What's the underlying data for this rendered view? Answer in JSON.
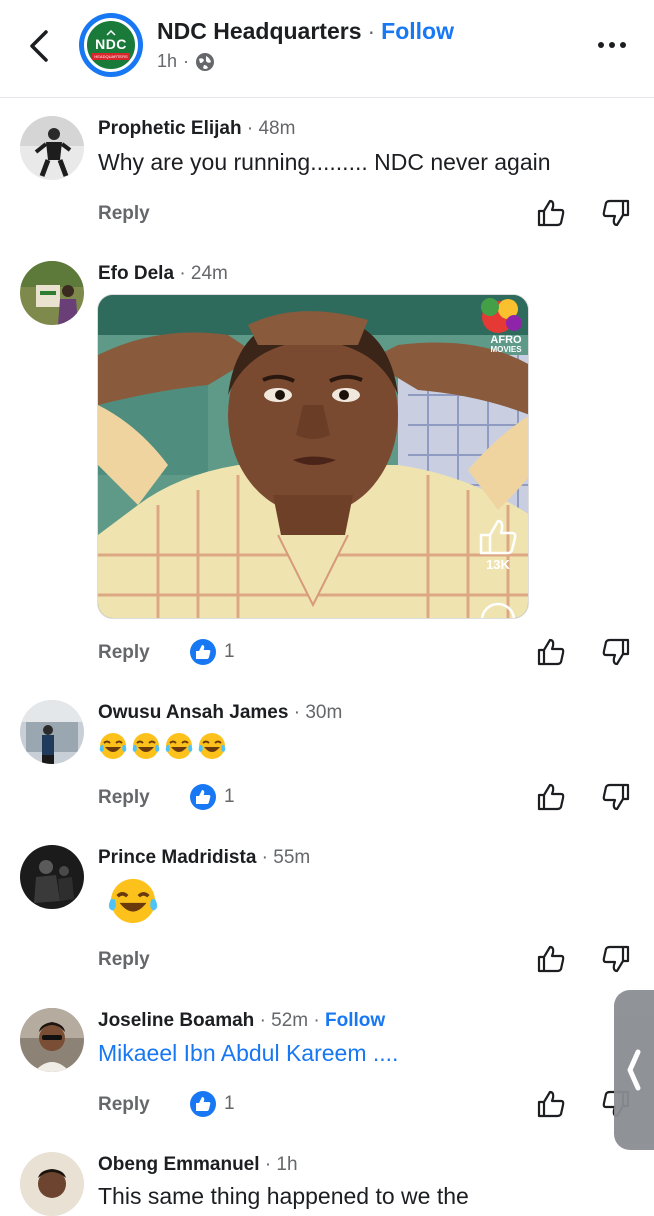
{
  "header": {
    "page_name": "NDC Headquarters",
    "separator": "·",
    "follow_label": "Follow",
    "time": "1h",
    "logo_text": "NDC",
    "logo_subtext": "HEADQUARTERS"
  },
  "comments": [
    {
      "author": "Prophetic Elijah",
      "time": "48m",
      "text": "Why are you running......... NDC never again",
      "reply_label": "Reply"
    },
    {
      "author": "Efo Dela",
      "time": "24m",
      "reply_label": "Reply",
      "like_count": "1",
      "media": {
        "watermark_line1": "AFRO",
        "watermark_line2": "MOVIES",
        "overlay_like_count": "13K"
      }
    },
    {
      "author": "Owusu Ansah James",
      "time": "30m",
      "emoji_count": 4,
      "emoji": "tears-of-joy",
      "reply_label": "Reply",
      "like_count": "1"
    },
    {
      "author": "Prince Madridista",
      "time": "55m",
      "emoji": "tears-of-joy",
      "reply_label": "Reply"
    },
    {
      "author": "Joseline Boamah",
      "time": "52m",
      "follow_label": "Follow",
      "text": "Mikaeel Ibn Abdul Kareem ....",
      "reply_label": "Reply",
      "like_count": "1"
    },
    {
      "author": "Obeng Emmanuel",
      "time": "1h",
      "text": "This same thing happened to we the"
    }
  ],
  "colors": {
    "accent": "#1877f2",
    "secondary_text": "#65676b",
    "primary_text": "#1c1e21",
    "ndc_green": "#1a7a3a",
    "ndc_red": "#d9262c"
  }
}
